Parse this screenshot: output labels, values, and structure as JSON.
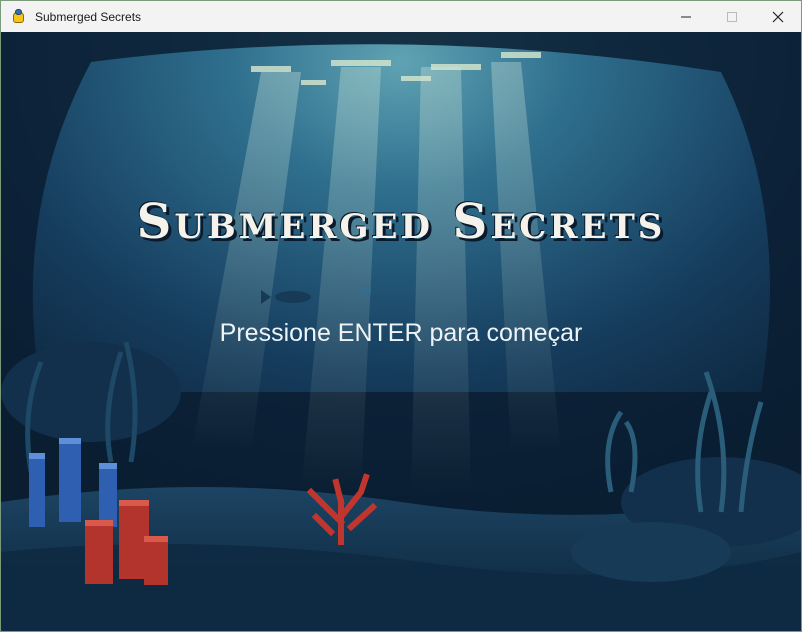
{
  "window": {
    "title": "Submerged Secrets",
    "icon": "pygame-snake-icon",
    "controls": [
      "minimize-icon",
      "maximize-icon",
      "close-icon"
    ]
  },
  "game": {
    "title": "Submerged Secrets",
    "prompt": "Pressione ENTER para começar"
  },
  "colors": {
    "deep_water": "#0b2238",
    "light_water": "#3f8aa3",
    "surface_light": "#d8e8cf",
    "coral_red": "#c0362e",
    "coral_blue": "#2f5fb0",
    "title_text": "#f4f2ea"
  }
}
